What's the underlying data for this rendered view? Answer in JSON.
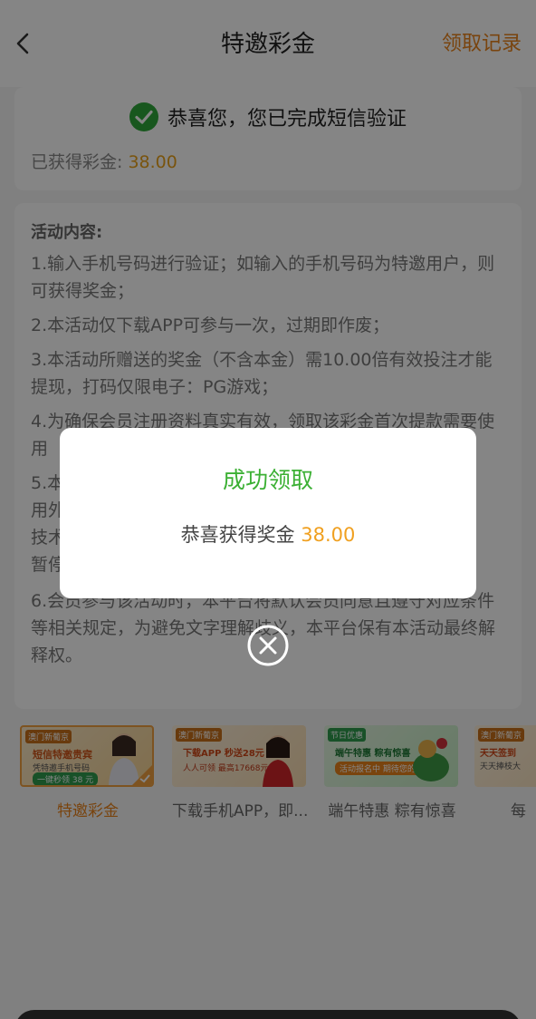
{
  "header": {
    "title": "特邀彩金",
    "record_link": "领取记录",
    "back_icon": "chevron-left-icon"
  },
  "verify": {
    "icon": "check-circle-icon",
    "message": "恭喜您，您已完成短信验证",
    "earned_label": "已获得彩金: ",
    "earned_amount": "38.00"
  },
  "content": {
    "title": "活动内容:",
    "rules": [
      "1.输入手机号码进行验证；如输入的手机号码为特邀用户，则可获得奖金；",
      "2.本活动仅下载APP可参与一次，过期即作废；",
      "3.本活动所赠送的奖金（不含本金）需10.00倍有效投注才能提现，打码仅限电子：PG游戏；",
      "4.为确保会员注册资料真实有效，领取该彩金首次提款需要使用",
      "5.本                                                                                 用外挂                                                                              技术手                                                                              暂停会                                                                              别通知；",
      "6.会员参与该活动时，本平台将默认会员同意且遵守对应条件等相关规定，为避免文字理解歧义，本平台保有本活动最终解释权。"
    ]
  },
  "tabs": [
    {
      "label": "特邀彩金",
      "banner": {
        "logo": "澳门新葡京",
        "line1": "短信特邀贵宾",
        "line2": "凭特邀手机号码",
        "button": "一键秒领 38 元"
      }
    },
    {
      "label": "下载手机APP，即...",
      "banner": {
        "logo": "澳门新葡京",
        "line1": "下载APP 秒送28元",
        "line2": "人人可领 最高17668元",
        "button": ""
      }
    },
    {
      "label": "端午特惠 粽有惊喜",
      "banner": {
        "logo": "节日优惠",
        "line1": "端午特惠 粽有惊喜",
        "line2": "",
        "button": "活动报名中 期待您的参与"
      }
    },
    {
      "label": "每",
      "banner": {
        "logo": "澳门新葡京",
        "line1": "天天签到",
        "line2": "天天捧枝大",
        "button": ""
      }
    }
  ],
  "modal": {
    "title": "成功领取",
    "message_prefix": "恭喜获得奖金 ",
    "amount": "38.00",
    "close_icon": "close-circle-icon"
  },
  "colors": {
    "accent_orange": "#e8821b",
    "amount_gold": "#f0a020",
    "success_green": "#3cb034"
  }
}
